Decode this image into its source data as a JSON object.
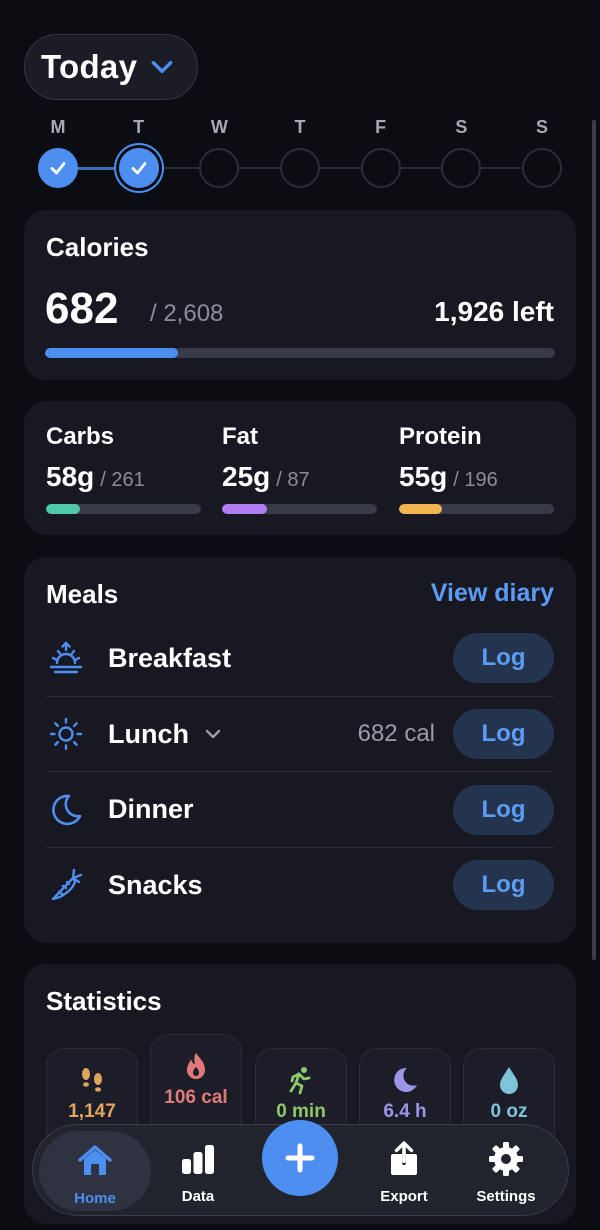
{
  "header": {
    "title": "Today"
  },
  "week": {
    "days": [
      {
        "letter": "M",
        "state": "done"
      },
      {
        "letter": "T",
        "state": "current"
      },
      {
        "letter": "W",
        "state": "empty"
      },
      {
        "letter": "T",
        "state": "empty"
      },
      {
        "letter": "F",
        "state": "empty"
      },
      {
        "letter": "S",
        "state": "empty"
      },
      {
        "letter": "S",
        "state": "empty"
      }
    ]
  },
  "calories": {
    "title": "Calories",
    "eaten": "682",
    "goal": "/ 2,608",
    "left": "1,926 left",
    "progress": 0.26,
    "color": "#4d8ff0"
  },
  "macros": [
    {
      "name": "Carbs",
      "value": "58g",
      "target": "/ 261",
      "progress": 0.22,
      "color": "#4fc9a8"
    },
    {
      "name": "Fat",
      "value": "25g",
      "target": "/ 87",
      "progress": 0.29,
      "color": "#b07cf2"
    },
    {
      "name": "Protein",
      "value": "55g",
      "target": "/ 196",
      "progress": 0.28,
      "color": "#f2b54f"
    }
  ],
  "meals": {
    "title": "Meals",
    "view_diary": "View diary",
    "items": [
      {
        "name": "Breakfast",
        "icon": "sunrise-icon",
        "calories": "",
        "log_label": "Log"
      },
      {
        "name": "Lunch",
        "icon": "sun-icon",
        "calories": "682 cal",
        "log_label": "Log"
      },
      {
        "name": "Dinner",
        "icon": "moon-icon",
        "calories": "",
        "log_label": "Log"
      },
      {
        "name": "Snacks",
        "icon": "carrot-icon",
        "calories": "",
        "log_label": "Log"
      }
    ]
  },
  "statistics": {
    "title": "Statistics",
    "items": [
      {
        "icon": "footprints-icon",
        "value": "1,147",
        "color": "#e0a45a"
      },
      {
        "icon": "flame-icon",
        "value": "106 cal",
        "color": "#e07a78"
      },
      {
        "icon": "running-icon",
        "value": "0 min",
        "color": "#8ec86a"
      },
      {
        "icon": "moon-icon",
        "value": "6.4 h",
        "color": "#9a96e8"
      },
      {
        "icon": "drop-icon",
        "value": "0 oz",
        "color": "#7fc3d6"
      }
    ]
  },
  "tabbar": {
    "home": "Home",
    "data": "Data",
    "export": "Export",
    "settings": "Settings",
    "accent": "#4d8ff0"
  }
}
